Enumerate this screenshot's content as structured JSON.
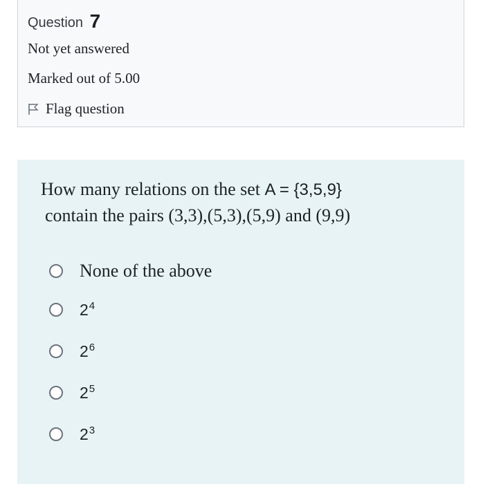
{
  "question": {
    "label": "Question",
    "number": "7",
    "state": "Not yet answered",
    "grade": "Marked out of 5.00",
    "flag_label": "Flag question"
  },
  "question_text": {
    "part1": "How many relations on the set ",
    "math1": "A = {3,5,9}",
    "part2": "contain the pairs ",
    "math2": "(3,3),(5,3),(5,9)",
    "part3": " and ",
    "math3": "(9,9)"
  },
  "options": [
    {
      "text": "None of the above"
    },
    {
      "base": "2",
      "exp": "4"
    },
    {
      "base": "2",
      "exp": "6"
    },
    {
      "base": "2",
      "exp": "5"
    },
    {
      "base": "2",
      "exp": "3"
    }
  ],
  "colors": {
    "info_bg": "#f8f9fa",
    "content_bg": "#e7f3f5",
    "text": "#1d2125"
  }
}
